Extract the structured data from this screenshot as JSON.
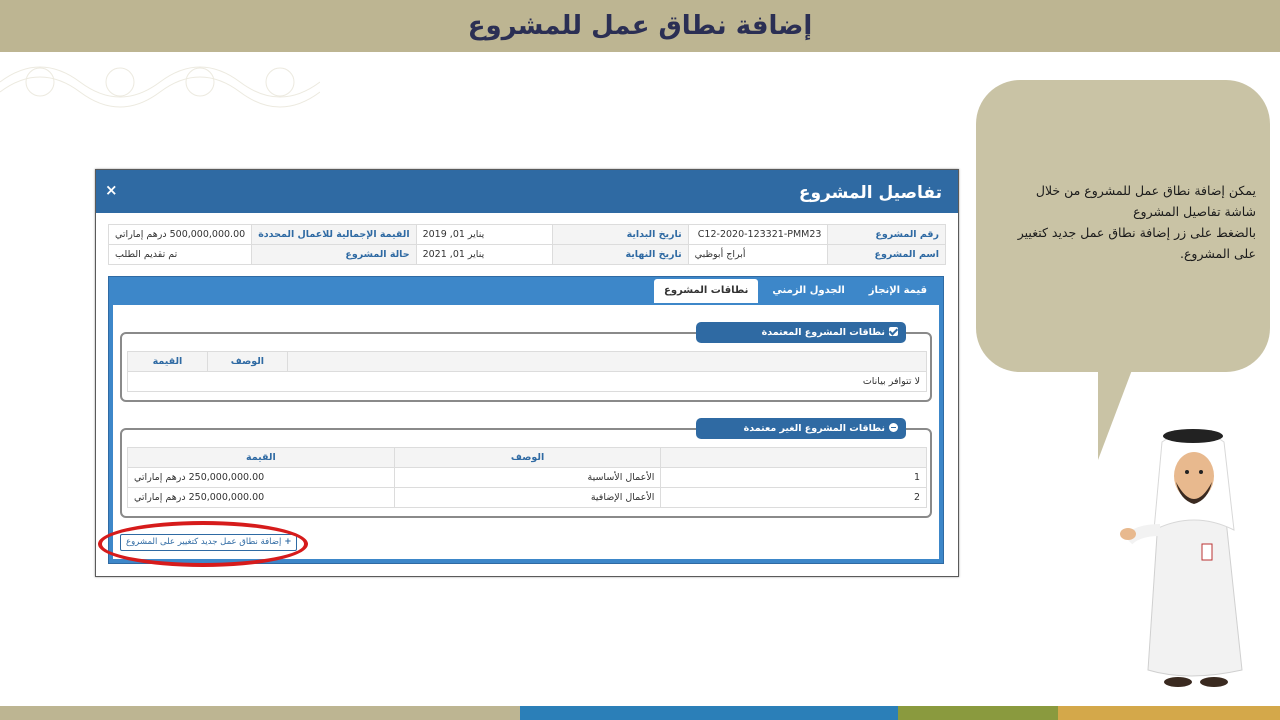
{
  "slide": {
    "title": "إضافة نطاق عمل للمشروع",
    "bubble_lines": [
      "يمكن إضافة نطاق عمل للمشروع من خلال",
      "شاشة تفاصيل المشروع",
      "بالضغط على زر إضافة نطاق عمل جديد كتغيير",
      "على المشروع."
    ],
    "colors": {
      "header_bg": "#bdb592",
      "title_color": "#2b2f54",
      "bubble_bg": "#c9c3a5",
      "highlight": "#d61b1b"
    }
  },
  "modal": {
    "title": "تفاصيل المشروع",
    "close_icon": "×",
    "info": {
      "project_number_label": "رقم المشروع",
      "project_number": "C12-2020-123321-PMM23",
      "start_date_label": "تاريخ البداية",
      "start_date": "يناير 01, 2019",
      "total_value_label": "القيمة الإجمالية للاعمال المحددة",
      "total_value": "500,000,000.00 درهم إماراتي",
      "project_name_label": "اسم المشروع",
      "project_name": "أبراج أبوظبي",
      "end_date_label": "تاريخ النهاية",
      "end_date": "يناير 01, 2021",
      "status_label": "حالة المشروع",
      "status": "تم تقديم الطلب"
    },
    "tabs": [
      {
        "label": "قيمة الإنجاز",
        "active": false
      },
      {
        "label": "الجدول الزمني",
        "active": false
      },
      {
        "label": "نطاقات المشروع",
        "active": true
      }
    ],
    "approved": {
      "legend": "نطاقات المشروع المعتمدة",
      "col_desc": "الوصف",
      "col_value": "القيمة",
      "empty": "لا تتوافر بيانات"
    },
    "unapproved": {
      "legend": "نطاقات المشروع الغير معتمدة",
      "col_desc": "الوصف",
      "col_value": "القيمة",
      "rows": [
        {
          "num": "1",
          "desc": "الأعمال الأساسية",
          "value": "250,000,000.00 درهم إماراتي"
        },
        {
          "num": "2",
          "desc": "الأعمال الإضافية",
          "value": "250,000,000.00 درهم إماراتي"
        }
      ]
    },
    "add_button": {
      "icon": "+",
      "label": "إضافة نطاق عمل جديد كتغيير على المشروع"
    }
  }
}
